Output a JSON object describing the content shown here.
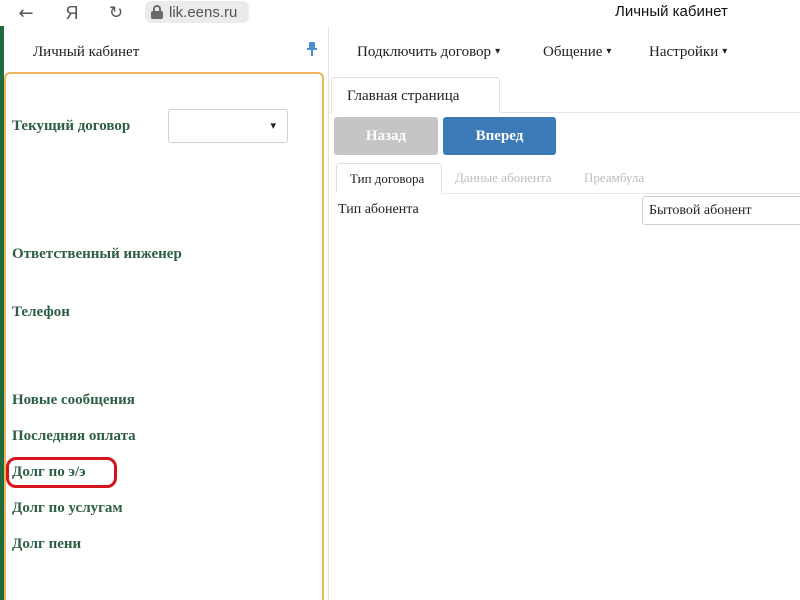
{
  "browser": {
    "url": "lik.eens.ru",
    "window_title": "Личный кабинет",
    "icons": {
      "back": "arrow-left-icon",
      "yandex": "yandex-logo-icon",
      "reload": "reload-icon",
      "lock": "lock-icon"
    },
    "glyphs": {
      "back": "←",
      "yandex": "Я",
      "reload": "↻"
    }
  },
  "sidebar": {
    "title": "Личный кабинет",
    "pin_icon": "pin-icon",
    "fields": {
      "current_contract": "Текущий договор",
      "responsible_engineer": "Ответственный инженер",
      "phone": "Телефон",
      "new_messages": "Новые сообщения",
      "last_payment": "Последняя оплата",
      "energy_debt": "Долг по э/э",
      "services_debt": "Долг по услугам",
      "penalty_debt": "Долг пени"
    },
    "contract_select": {
      "value": "",
      "caret": "▾"
    }
  },
  "menu": {
    "items": [
      "Подключить договор",
      "Общение",
      "Настройки"
    ],
    "arrow": "▾"
  },
  "page_tab": "Главная страница",
  "buttons": {
    "back": "Назад",
    "forward": "Вперед"
  },
  "sub_tabs": {
    "contract_type": "Тип договора",
    "subscriber_data": "Данные абонента",
    "preamble": "Преамбула"
  },
  "form": {
    "subscriber_type_label": "Тип абонента",
    "subscriber_type_value": "Бытовой абонент"
  },
  "colors": {
    "accent_blue": "#3d7ab8",
    "disabled_button": "#c5c5c5",
    "label_green": "#2e5e45",
    "panel_border": "#f0b45a",
    "highlight_red": "#d4141a",
    "app_strip": "#1f6b3e"
  }
}
